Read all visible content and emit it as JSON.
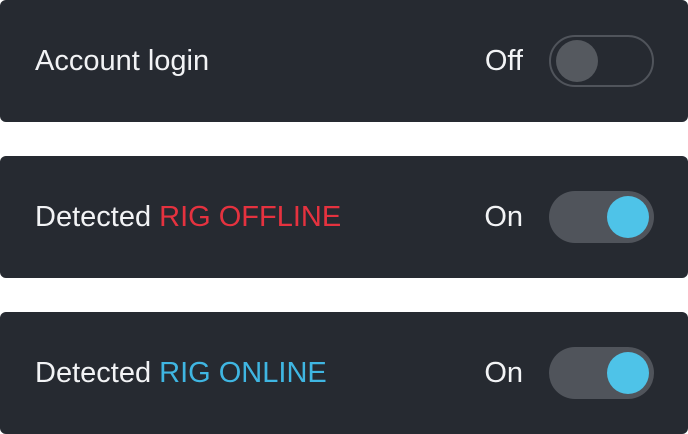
{
  "settings": [
    {
      "label_prefix": "Account login",
      "label_highlight": "",
      "highlight_color": "",
      "state_text": "Off",
      "enabled": false
    },
    {
      "label_prefix": "Detected",
      "label_highlight": "RIG OFFLINE",
      "highlight_color": "#e5323f",
      "state_text": "On",
      "enabled": true
    },
    {
      "label_prefix": "Detected",
      "label_highlight": "RIG ONLINE",
      "highlight_color": "#3fb6e2",
      "state_text": "On",
      "enabled": true
    }
  ],
  "colors": {
    "panel_background": "#262a31",
    "text": "#f2f3f5",
    "toggle_track": "#50545b",
    "toggle_knob_on": "#4ec3e8",
    "toggle_knob_off": "#55595f"
  }
}
